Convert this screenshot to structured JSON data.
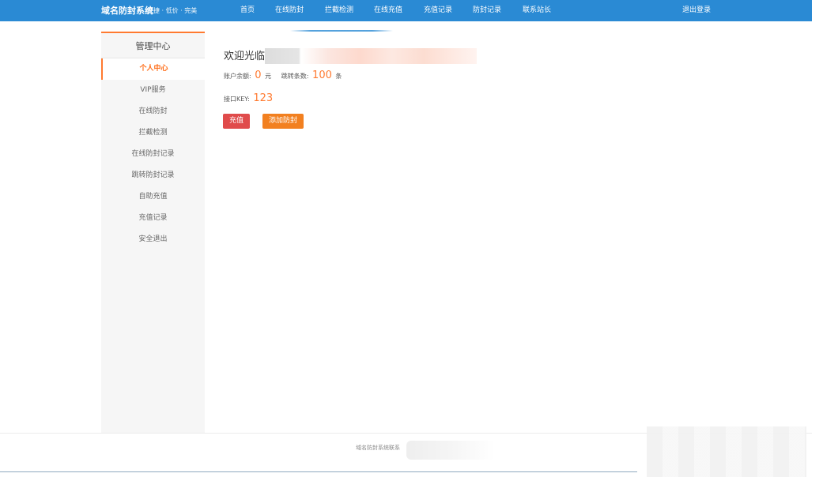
{
  "header": {
    "brand": "域名防封系统",
    "slogan": "快捷 · 低价 · 完美",
    "nav": [
      {
        "label": "首页"
      },
      {
        "label": "在线防封"
      },
      {
        "label": "拦截检测"
      },
      {
        "label": "在线充值"
      },
      {
        "label": "充值记录"
      },
      {
        "label": "防封记录"
      },
      {
        "label": "联系站长"
      }
    ],
    "logout": "退出登录",
    "bar_color": "#2a8ad4"
  },
  "sidebar": {
    "title": "管理中心",
    "items": [
      {
        "label": "个人中心",
        "active": true
      },
      {
        "label": "VIP服务"
      },
      {
        "label": "在线防封"
      },
      {
        "label": "拦截检测"
      },
      {
        "label": "在线防封记录"
      },
      {
        "label": "跳转防封记录"
      },
      {
        "label": "自助充值"
      },
      {
        "label": "充值记录"
      },
      {
        "label": "安全退出"
      }
    ],
    "accent_color": "#ff7a30"
  },
  "main": {
    "welcome": "欢迎光临",
    "balance_label": "账户余额:",
    "balance_value": "0",
    "balance_unit": "元",
    "jumps_label": "跳转条数:",
    "jumps_value": "100",
    "jumps_unit": "条",
    "key_label": "接口KEY:",
    "key_value": "123",
    "recharge_button": "充值",
    "add_button": "添加防封"
  },
  "footer": {
    "text": "域名防封系统联系"
  }
}
